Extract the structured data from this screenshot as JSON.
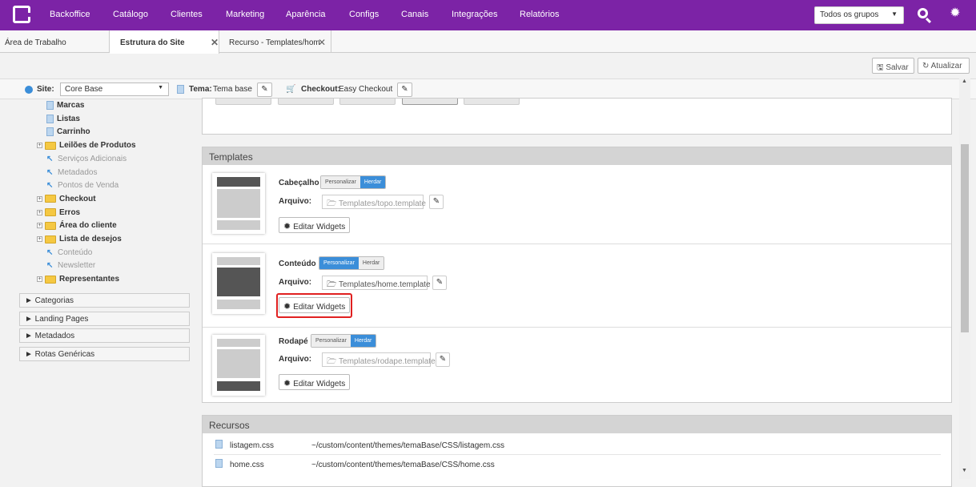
{
  "nav": {
    "items": [
      "Backoffice",
      "Catálogo",
      "Clientes",
      "Marketing",
      "Aparência",
      "Configs",
      "Canais",
      "Integrações",
      "Relatórios"
    ],
    "group_select": "Todos os grupos"
  },
  "tabs": [
    {
      "label": "Área de Trabalho"
    },
    {
      "label": "Estrutura do Site"
    },
    {
      "label": "Recurso - Templates/hom"
    }
  ],
  "toolbar": {
    "save": "Salvar",
    "refresh": "Atualizar"
  },
  "sitebar": {
    "site_label": "Site:",
    "site_value": "Core Base",
    "theme_label": "Tema:",
    "theme_value": "Tema base",
    "checkout_label": "Checkout:",
    "checkout_value": "Easy Checkout"
  },
  "tree": [
    {
      "label": "Marcas",
      "type": "page",
      "style": "bold"
    },
    {
      "label": "Listas",
      "type": "page",
      "style": "bold"
    },
    {
      "label": "Carrinho",
      "type": "page",
      "style": "bold"
    },
    {
      "label": "Leilões de Produtos",
      "type": "folder",
      "style": "bold"
    },
    {
      "label": "Serviços Adicionais",
      "type": "arrow",
      "style": "muted"
    },
    {
      "label": "Metadados",
      "type": "arrow",
      "style": "muted"
    },
    {
      "label": "Pontos de Venda",
      "type": "arrow",
      "style": "muted"
    },
    {
      "label": "Checkout",
      "type": "folder",
      "style": "bold"
    },
    {
      "label": "Erros",
      "type": "folder",
      "style": "bold"
    },
    {
      "label": "Área do cliente",
      "type": "folder",
      "style": "bold"
    },
    {
      "label": "Lista de desejos",
      "type": "folder",
      "style": "bold"
    },
    {
      "label": "Conteúdo",
      "type": "arrow",
      "style": "muted"
    },
    {
      "label": "Newsletter",
      "type": "arrow",
      "style": "muted"
    },
    {
      "label": "Representantes",
      "type": "folder",
      "style": "bold"
    }
  ],
  "accordions": [
    "► Categorias",
    "► Landing Pages",
    "► Metadados",
    "► Rotas Genéricas"
  ],
  "templates": {
    "title": "Templates",
    "arquivo_label": "Arquivo:",
    "personalizar": "Personalizar",
    "herdar": "Herdar",
    "widgets": "Editar Widgets",
    "rows": [
      {
        "name": "Cabeçalho",
        "active": "Herdar",
        "file": "Templates/topo.template"
      },
      {
        "name": "Conteúdo",
        "active": "Personalizar",
        "file": "Templates/home.template"
      },
      {
        "name": "Rodapé",
        "active": "Herdar",
        "file": "Templates/rodape.template"
      }
    ]
  },
  "recursos": {
    "title": "Recursos",
    "rows": [
      {
        "file": "listagem.css",
        "path": "~/custom/content/themes/temaBase/CSS/listagem.css"
      },
      {
        "file": "home.css",
        "path": "~/custom/content/themes/temaBase/CSS/home.css"
      }
    ]
  },
  "colors": {
    "nav": "#7c23a6",
    "accent": "#3b8ed9",
    "highlight": "#e02020"
  }
}
